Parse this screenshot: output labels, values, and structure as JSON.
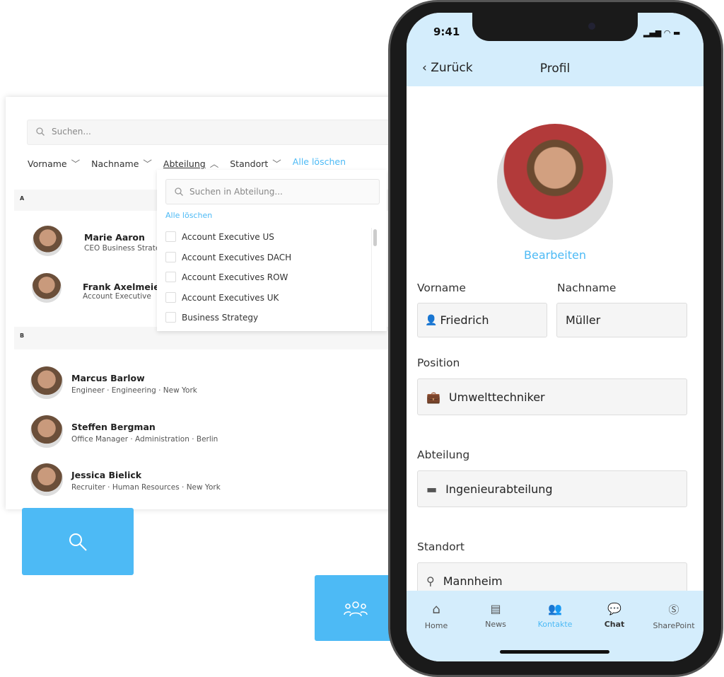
{
  "desktop": {
    "search_placeholder": "Suchen...",
    "filters": [
      {
        "label": "Vorname"
      },
      {
        "label": "Nachname"
      },
      {
        "label": "Abteilung"
      },
      {
        "label": "Standort"
      }
    ],
    "clear_all": "Alle löschen",
    "groups": [
      {
        "letter": "A",
        "people": [
          {
            "name": "Marie Aaron",
            "sub": "CEO  Business Strate"
          },
          {
            "name": "Frank Axelmeier",
            "sub": "Account Executive"
          }
        ]
      },
      {
        "letter": "B",
        "people": [
          {
            "name": "Marcus Barlow",
            "sub": "Engineer · Engineering · New York"
          },
          {
            "name": "Steffen Bergman",
            "sub": "Office Manager · Administration · Berlin"
          },
          {
            "name": "Jessica Bielick",
            "sub": "Recruiter · Human Resources · New York"
          }
        ]
      }
    ],
    "dropdown": {
      "search_placeholder": "Suchen in Abteilung...",
      "clear_all": "Alle löschen",
      "options": [
        "Account Executive US",
        "Account Executives DACH",
        "Account Executives ROW",
        "Account Executives UK",
        "Business Strategy"
      ]
    }
  },
  "buttons": {
    "search_icon": "search-icon",
    "contacts_icon": "users-icon"
  },
  "phone": {
    "time": "9:41",
    "back": "Zurück",
    "title": "Profil",
    "edit": "Bearbeiten",
    "fields": {
      "vorname_label": "Vorname",
      "vorname": "Friedrich",
      "nachname_label": "Nachname",
      "nachname": "Müller",
      "position_label": "Position",
      "position": "Umwelttechniker",
      "abteilung_label": "Abteilung",
      "abteilung": "Ingenieurabteilung",
      "standort_label": "Standort",
      "standort": "Mannheim"
    },
    "tabs": [
      {
        "label": "Home",
        "icon": "home-icon"
      },
      {
        "label": "News",
        "icon": "news-icon"
      },
      {
        "label": "Kontakte",
        "icon": "contacts-icon",
        "active": true
      },
      {
        "label": "Chat",
        "icon": "chat-icon"
      },
      {
        "label": "SharePoint",
        "icon": "sharepoint-icon"
      }
    ]
  },
  "colors": {
    "accent": "#4dbaf5",
    "header_bg": "#d4edfc"
  }
}
